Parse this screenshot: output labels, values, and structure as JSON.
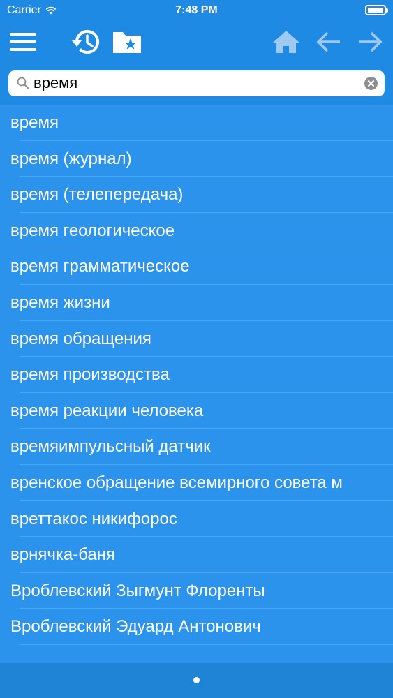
{
  "status": {
    "carrier": "Carrier",
    "time": "7:48 PM"
  },
  "toolbar": {
    "icons": [
      "menu-icon",
      "history-icon",
      "favorites-folder-icon",
      "home-icon",
      "back-arrow-icon",
      "forward-arrow-icon"
    ]
  },
  "search": {
    "value": "время"
  },
  "results": [
    "время",
    "время (журнал)",
    "время (телепередача)",
    "время геологическое",
    "время грамматическое",
    "время жизни",
    "время обращения",
    "время производства",
    "время реакции человека",
    "времяимпульсный датчик",
    "вренское обращение всемирного совета м",
    "вреттакос никифорос",
    "врнячка-баня",
    "Вроблевский Зыгмунт Флоренты",
    "Вроблевский Эдуард Антонович"
  ],
  "colors": {
    "toolbar": "#1f8ae4",
    "list": "#2b93ec",
    "footer": "#1f83d6",
    "nav_disabled": "#9fc9f2"
  }
}
